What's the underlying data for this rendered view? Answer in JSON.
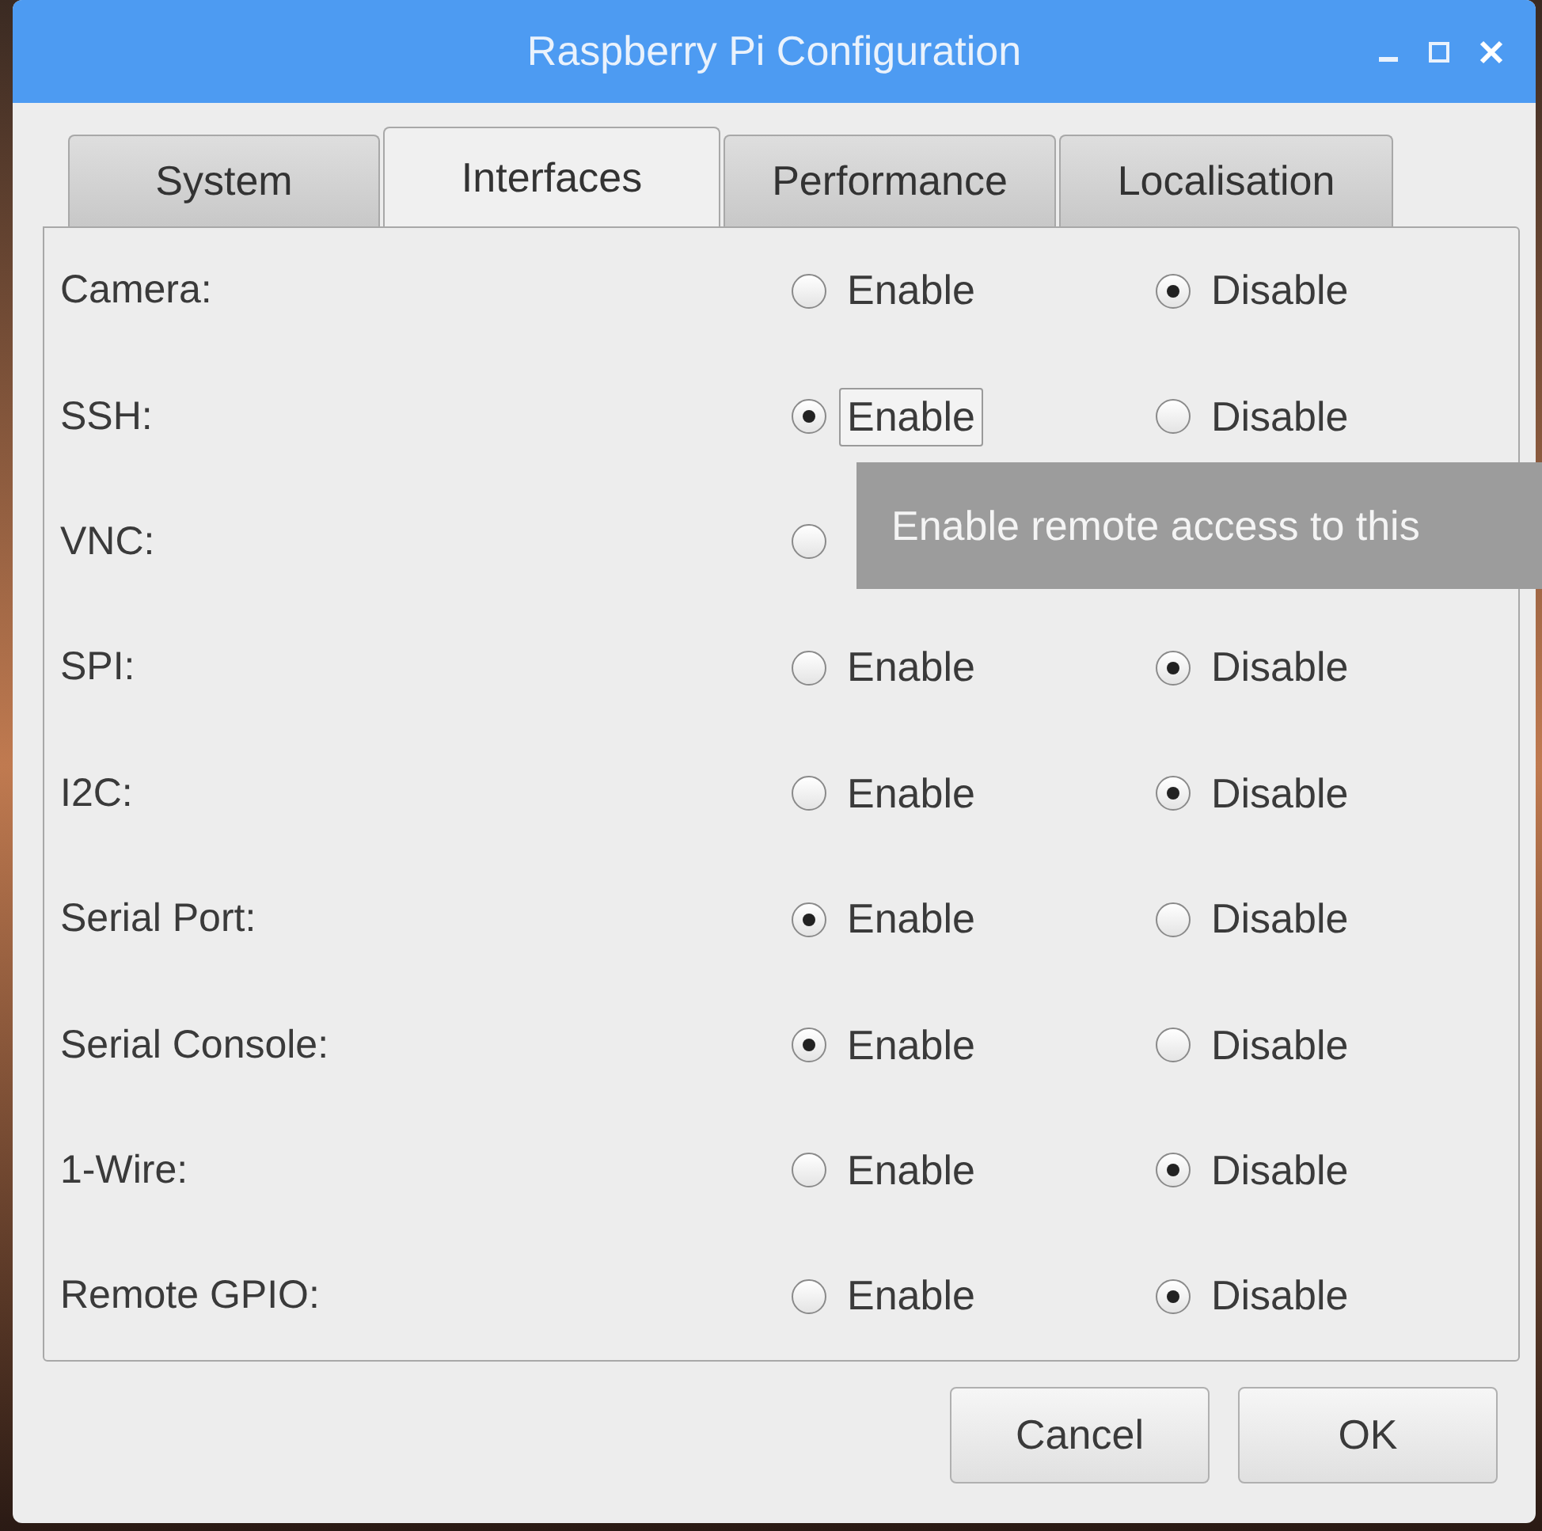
{
  "window": {
    "title": "Raspberry Pi Configuration"
  },
  "tabs": [
    {
      "label": "System",
      "selected": false
    },
    {
      "label": "Interfaces",
      "selected": true
    },
    {
      "label": "Performance",
      "selected": false
    },
    {
      "label": "Localisation",
      "selected": false
    }
  ],
  "rows": [
    {
      "label": "Camera:",
      "options": [
        {
          "label": "Enable",
          "selected": false,
          "focused": false
        },
        {
          "label": "Disable",
          "selected": true,
          "focused": false
        }
      ]
    },
    {
      "label": "SSH:",
      "options": [
        {
          "label": "Enable",
          "selected": true,
          "focused": true
        },
        {
          "label": "Disable",
          "selected": false,
          "focused": false
        }
      ]
    },
    {
      "label": "VNC:",
      "options": [
        {
          "selected": false,
          "focused": false
        }
      ]
    },
    {
      "label": "SPI:",
      "options": [
        {
          "label": "Enable",
          "selected": false,
          "focused": false
        },
        {
          "label": "Disable",
          "selected": true,
          "focused": false
        }
      ]
    },
    {
      "label": "I2C:",
      "options": [
        {
          "label": "Enable",
          "selected": false,
          "focused": false
        },
        {
          "label": "Disable",
          "selected": true,
          "focused": false
        }
      ]
    },
    {
      "label": "Serial Port:",
      "options": [
        {
          "label": "Enable",
          "selected": true,
          "focused": false
        },
        {
          "label": "Disable",
          "selected": false,
          "focused": false
        }
      ]
    },
    {
      "label": "Serial Console:",
      "options": [
        {
          "label": "Enable",
          "selected": true,
          "focused": false
        },
        {
          "label": "Disable",
          "selected": false,
          "focused": false
        }
      ]
    },
    {
      "label": "1-Wire:",
      "options": [
        {
          "label": "Enable",
          "selected": false,
          "focused": false
        },
        {
          "label": "Disable",
          "selected": true,
          "focused": false
        }
      ]
    },
    {
      "label": "Remote GPIO:",
      "options": [
        {
          "label": "Enable",
          "selected": false,
          "focused": false
        },
        {
          "label": "Disable",
          "selected": true,
          "focused": false
        }
      ]
    }
  ],
  "tooltip": {
    "text": "Enable remote access to this"
  },
  "buttons": [
    "Cancel",
    "OK"
  ]
}
